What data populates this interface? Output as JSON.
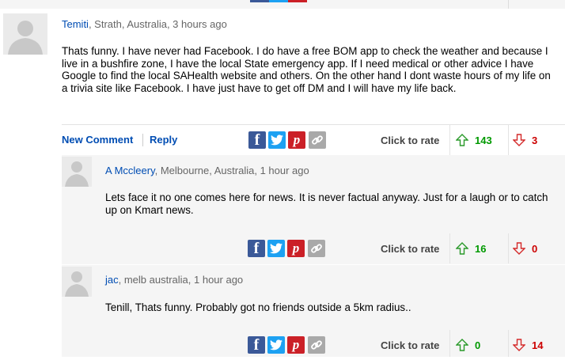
{
  "comments": [
    {
      "author": "Temiti",
      "meta": ", Strath, Australia, 3 hours ago",
      "body": "Thats funny. I have never had Facebook. I do have a free BOM app to check the weather and because I live in a bushfire zone, I have the local State emergency app. If I need medical or other advice I have Google to find the local SAHealth website and others. On the other hand I dont waste hours of my life on a trivia site like Facebook. I have just have to get off DM and I will have my life back.",
      "new_comment_label": "New Comment",
      "reply_label": "Reply",
      "rate_label": "Click to rate",
      "up_count": "143",
      "down_count": "3"
    },
    {
      "author": "A Mccleery",
      "meta": ", Melbourne, Australia, 1 hour ago",
      "body": "Lets face it no one comes here for news. It is never factual anyway. Just for a laugh or to catch up on Kmart news.",
      "rate_label": "Click to rate",
      "up_count": "16",
      "down_count": "0"
    },
    {
      "author": "jac",
      "meta": ", melb australia, 1 hour ago",
      "body": "Tenill, Thats funny. Probably got no friends outside a 5km radius..",
      "rate_label": "Click to rate",
      "up_count": "0",
      "down_count": "14"
    }
  ],
  "share_icons": [
    "facebook-icon",
    "twitter-icon",
    "pinterest-icon",
    "link-icon"
  ],
  "colors": {
    "link_blue": "#004db3",
    "up_green": "#009900",
    "down_red": "#cc0000",
    "facebook": "#3b5998",
    "twitter": "#1da1f2",
    "pinterest": "#cb2027",
    "share_link": "#a9a9a9"
  }
}
